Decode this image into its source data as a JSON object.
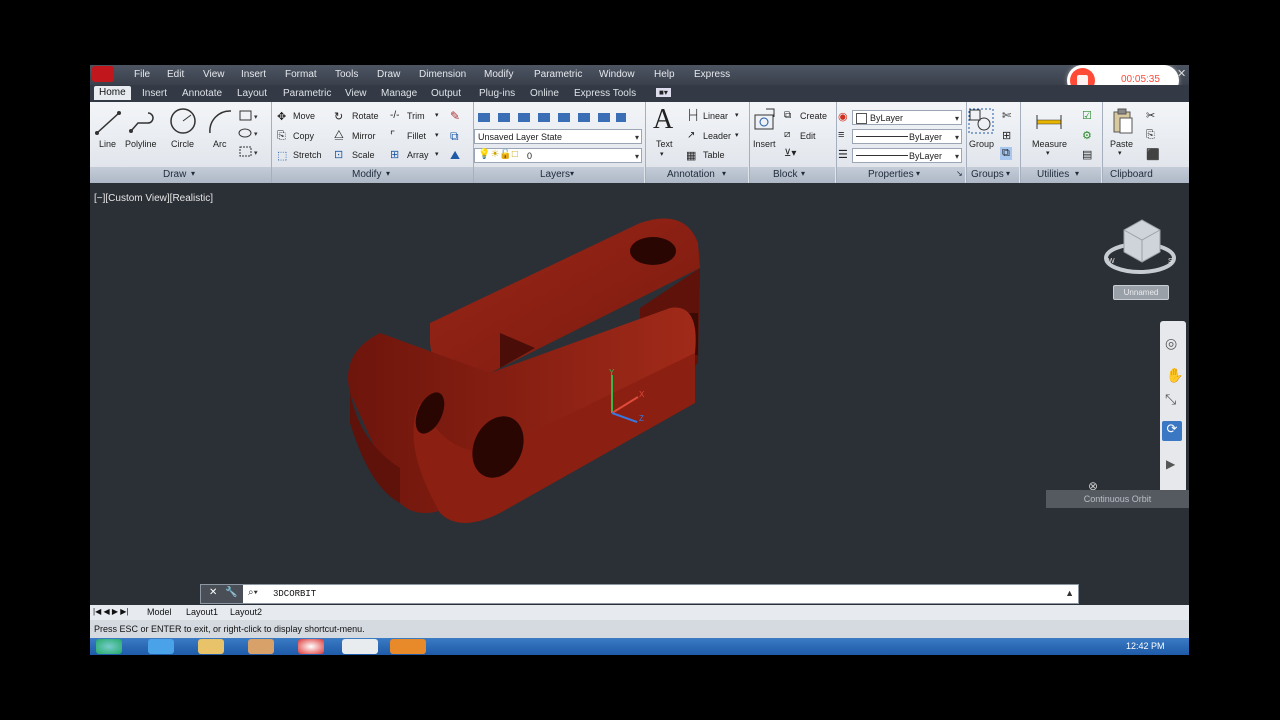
{
  "menubar": {
    "items": [
      "File",
      "Edit",
      "View",
      "Insert",
      "Format",
      "Tools",
      "Draw",
      "Dimension",
      "Modify",
      "Parametric",
      "Window",
      "Help",
      "Express"
    ]
  },
  "recording": {
    "time": "00:05:35"
  },
  "ribbon_tabs": [
    "Home",
    "Insert",
    "Annotate",
    "Layout",
    "Parametric",
    "View",
    "Manage",
    "Output",
    "Plug-ins",
    "Online",
    "Express Tools"
  ],
  "draw": {
    "title": "Draw",
    "line": "Line",
    "polyline": "Polyline",
    "circle": "Circle",
    "arc": "Arc"
  },
  "modify": {
    "title": "Modify",
    "move": "Move",
    "rotate": "Rotate",
    "trim": "Trim",
    "copy": "Copy",
    "mirror": "Mirror",
    "fillet": "Fillet",
    "stretch": "Stretch",
    "scale": "Scale",
    "array": "Array"
  },
  "layers": {
    "title": "Layers",
    "layer_state": "Unsaved Layer State",
    "current_layer": "0"
  },
  "annotation": {
    "title": "Annotation",
    "text": "Text",
    "linear": "Linear",
    "leader": "Leader",
    "table": "Table"
  },
  "block": {
    "title": "Block",
    "insert": "Insert",
    "create": "Create",
    "edit": "Edit"
  },
  "properties": {
    "title": "Properties",
    "color": "ByLayer",
    "linetype": "ByLayer",
    "lineweight": "ByLayer"
  },
  "groups": {
    "title": "Groups",
    "group": "Group"
  },
  "utilities": {
    "title": "Utilities",
    "measure": "Measure"
  },
  "clipboard": {
    "title": "Clipboard",
    "paste": "Paste"
  },
  "viewport": {
    "label": "[−][Custom View][Realistic]",
    "named_view": "Unnamed",
    "tooltip": "Continuous Orbit",
    "axis_x": "X",
    "axis_y": "Y",
    "axis_z": "Z",
    "model_color": "#8b1e12"
  },
  "command": {
    "text": "3DCORBIT"
  },
  "layout_tabs": [
    "Model",
    "Layout1",
    "Layout2"
  ],
  "status": {
    "text": "Press ESC or ENTER to exit, or right-click to display shortcut-menu."
  },
  "taskbar": {
    "clock": "12:42 PM"
  }
}
